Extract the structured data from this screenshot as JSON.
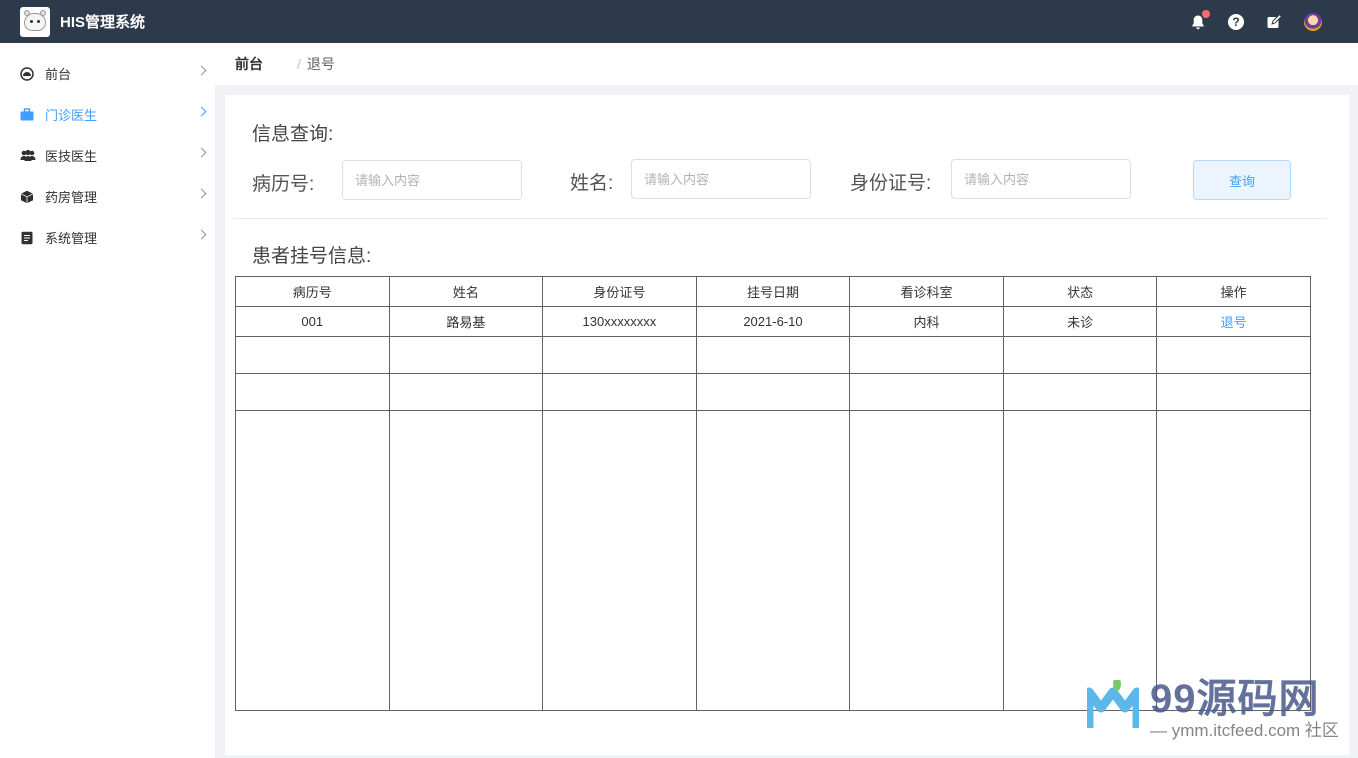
{
  "app": {
    "title": "HIS管理系统"
  },
  "topbar": {
    "icons": [
      "bell-icon",
      "help-icon",
      "edit-icon",
      "avatar"
    ],
    "help_glyph": "?"
  },
  "sidebar": {
    "items": [
      {
        "label": "前台",
        "icon": "dashboard-icon",
        "active": false
      },
      {
        "label": "门诊医生",
        "icon": "briefcase-icon",
        "active": true
      },
      {
        "label": "医技医生",
        "icon": "users-icon",
        "active": false
      },
      {
        "label": "药房管理",
        "icon": "box-icon",
        "active": false
      },
      {
        "label": "系统管理",
        "icon": "document-icon",
        "active": false
      }
    ]
  },
  "breadcrumb": {
    "home": "前台",
    "separator": "/",
    "current": "退号"
  },
  "search": {
    "title": "信息查询:",
    "fields": [
      {
        "label": "病历号:",
        "placeholder": "请输入内容"
      },
      {
        "label": "姓名:",
        "placeholder": "请输入内容"
      },
      {
        "label": "身份证号:",
        "placeholder": "请输入内容"
      }
    ],
    "button": "查询"
  },
  "table": {
    "title": "患者挂号信息:",
    "columns": [
      "病历号",
      "姓名",
      "身份证号",
      "挂号日期",
      "看诊科室",
      "状态",
      "操作"
    ],
    "rows": [
      {
        "id": "001",
        "name": "路易基",
        "idcard": "130xxxxxxxx",
        "date": "2021-6-10",
        "dept": "内科",
        "status": "未诊",
        "action": "退号"
      }
    ]
  },
  "watermark": {
    "title": "99源码网",
    "subtitle": "— ymm.itcfeed.com 社区"
  },
  "colors": {
    "topbar": "#2d3a4b",
    "accent": "#409eff",
    "active_menu": "#409eff"
  }
}
